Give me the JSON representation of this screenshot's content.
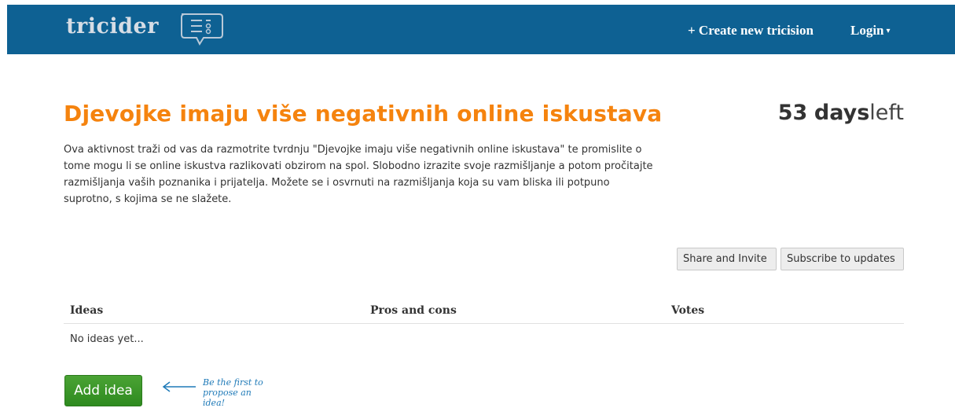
{
  "header": {
    "logo_text": "tricider",
    "create_label": "+ Create new tricision",
    "login_label": "Login",
    "background_color": "#0e6193"
  },
  "main": {
    "title": "Djevojke imaju više negativnih online iskustava",
    "days_number": "53",
    "days_word": "days",
    "days_suffix": "left",
    "description": "Ova aktivnost traži od vas da razmotrite tvrdnju \"Djevojke imaju više negativnih online iskustava\" te promislite o tome mogu li se online iskustva razlikovati obzirom na spol. Slobodno izrazite svoje razmišljanje a potom pročitajte razmišljanja vaših poznanika i prijatelja. Možete se i osvrnuti na razmišljanja koja su vam bliska ili potpuno suprotno, s kojima se ne slažete.",
    "title_color": "#f5830e"
  },
  "actions": {
    "share_label": "Share and Invite",
    "subscribe_label": "Subscribe to updates"
  },
  "table": {
    "columns": [
      "Ideas",
      "Pros and cons",
      "Votes"
    ],
    "empty_text": "No ideas yet..."
  },
  "footer": {
    "add_idea_label": "Add idea",
    "hint_line1": "Be the first to",
    "hint_line2": "propose an idea!",
    "add_idea_color": "#3b9a2a"
  },
  "icons": [
    "logo-speech-bubble-icon",
    "caret-down-icon",
    "arrow-left-icon"
  ]
}
